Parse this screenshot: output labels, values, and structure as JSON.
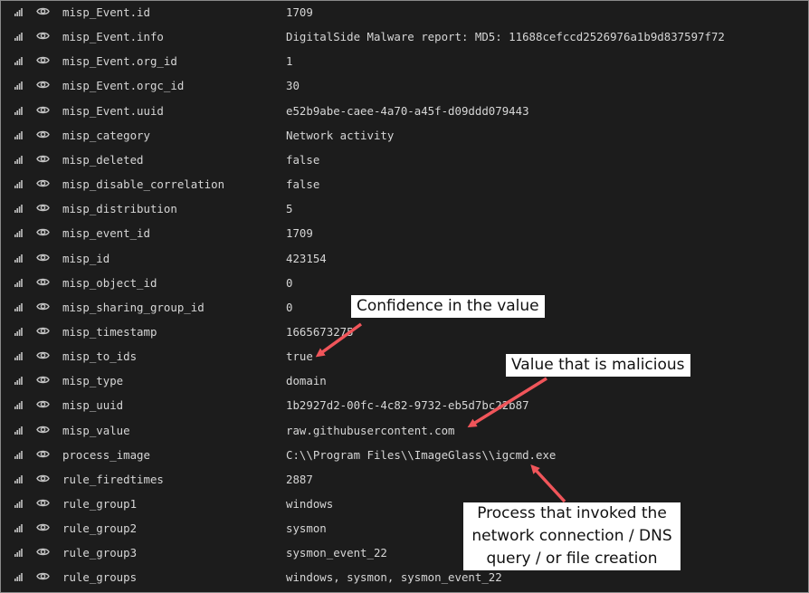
{
  "rows": [
    {
      "field": "misp_Event.id",
      "value": "1709"
    },
    {
      "field": "misp_Event.info",
      "value": "DigitalSide Malware report: MD5: 11688cefccd2526976a1b9d837597f72"
    },
    {
      "field": "misp_Event.org_id",
      "value": "1"
    },
    {
      "field": "misp_Event.orgc_id",
      "value": "30"
    },
    {
      "field": "misp_Event.uuid",
      "value": "e52b9abe-caee-4a70-a45f-d09ddd079443"
    },
    {
      "field": "misp_category",
      "value": "Network activity"
    },
    {
      "field": "misp_deleted",
      "value": "false"
    },
    {
      "field": "misp_disable_correlation",
      "value": "false"
    },
    {
      "field": "misp_distribution",
      "value": "5"
    },
    {
      "field": "misp_event_id",
      "value": "1709"
    },
    {
      "field": "misp_id",
      "value": "423154"
    },
    {
      "field": "misp_object_id",
      "value": "0"
    },
    {
      "field": "misp_sharing_group_id",
      "value": "0"
    },
    {
      "field": "misp_timestamp",
      "value": "1665673275"
    },
    {
      "field": "misp_to_ids",
      "value": "true"
    },
    {
      "field": "misp_type",
      "value": "domain"
    },
    {
      "field": "misp_uuid",
      "value": "1b2927d2-00fc-4c82-9732-eb5d7bc22b87"
    },
    {
      "field": "misp_value",
      "value": "raw.githubusercontent.com"
    },
    {
      "field": "process_image",
      "value": "C:\\\\Program Files\\\\ImageGlass\\\\igcmd.exe"
    },
    {
      "field": "rule_firedtimes",
      "value": "2887"
    },
    {
      "field": "rule_group1",
      "value": "windows"
    },
    {
      "field": "rule_group2",
      "value": "sysmon"
    },
    {
      "field": "rule_group3",
      "value": "sysmon_event_22"
    },
    {
      "field": "rule_groups",
      "value": "windows, sysmon, sysmon_event_22"
    }
  ],
  "icons": {
    "row_action": "bar-chart-icon",
    "row_toggle": "eye-icon"
  },
  "annotations": {
    "confidence": "Confidence in the value",
    "malicious": "Value that is malicious",
    "process_line1": "Process that invoked the",
    "process_line2": "network connection / DNS",
    "process_line3": "query / or file creation"
  },
  "colors": {
    "background": "#1c1c1c",
    "text": "#d6d6d6",
    "icon": "#c2c2c2",
    "arrow": "#f0555a",
    "annotation_bg": "#ffffff"
  }
}
